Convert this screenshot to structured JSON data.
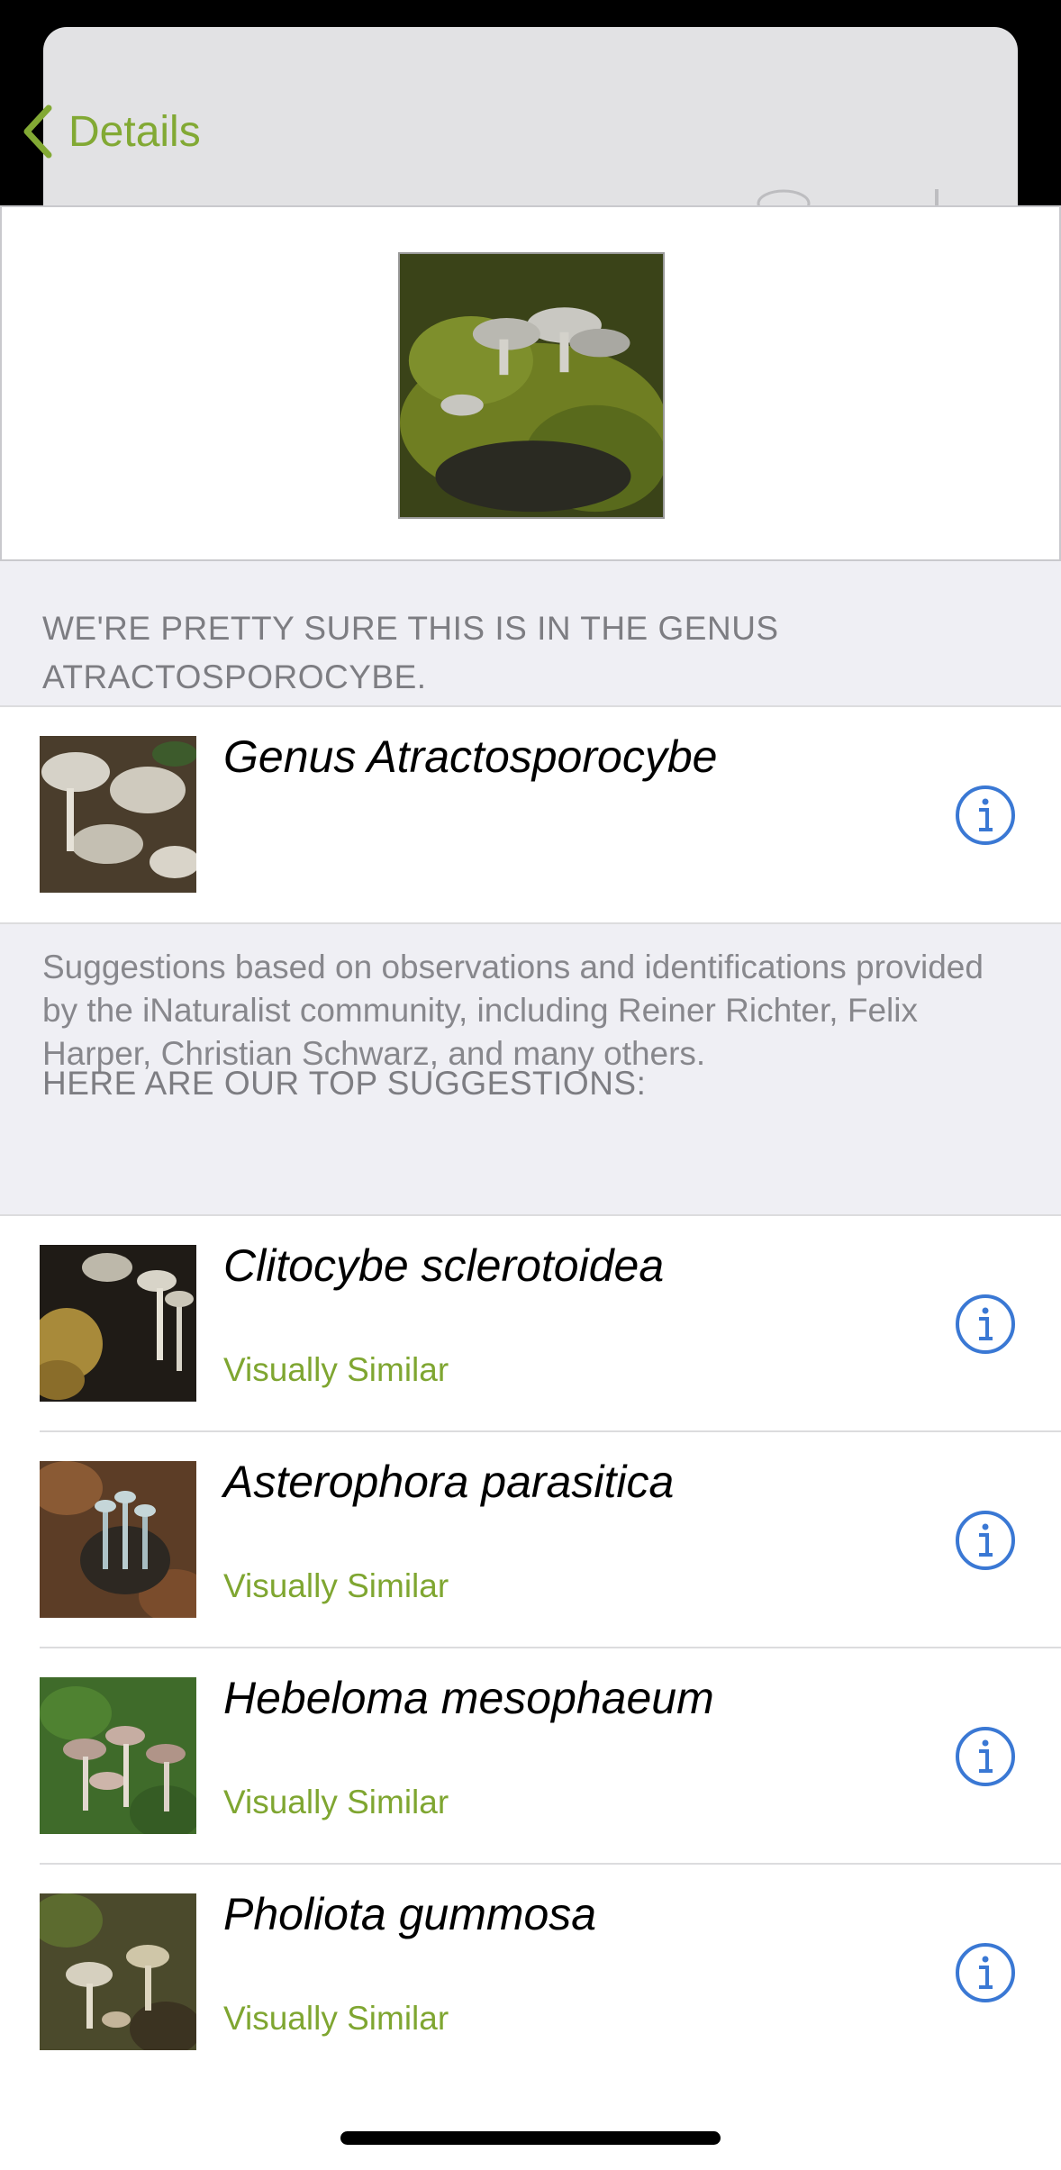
{
  "nav": {
    "back_label": "Details"
  },
  "confidence": {
    "header": "WE'RE PRETTY SURE THIS IS IN THE GENUS ATRACTOSPOROCYBE.",
    "taxon": "Genus Atractosporocybe"
  },
  "attribution": "Suggestions based on observations and identifications provided by the iNaturalist community, including Reiner Richter, Felix Harper, Christian Schwarz, and many others.",
  "suggestions_header": "HERE ARE OUR TOP SUGGESTIONS:",
  "suggestions": [
    {
      "name": "Clitocybe sclerotoidea",
      "tag": "Visually Similar"
    },
    {
      "name": "Asterophora parasitica",
      "tag": "Visually Similar"
    },
    {
      "name": "Hebeloma mesophaeum",
      "tag": "Visually Similar"
    },
    {
      "name": "Pholiota gummosa",
      "tag": "Visually Similar"
    }
  ],
  "icons": {
    "back": "chevron-left-icon",
    "info": "info-circle-icon"
  },
  "colors": {
    "accent_green": "#82a934",
    "info_blue": "#3a78d4",
    "group_bg": "#efeff4"
  }
}
